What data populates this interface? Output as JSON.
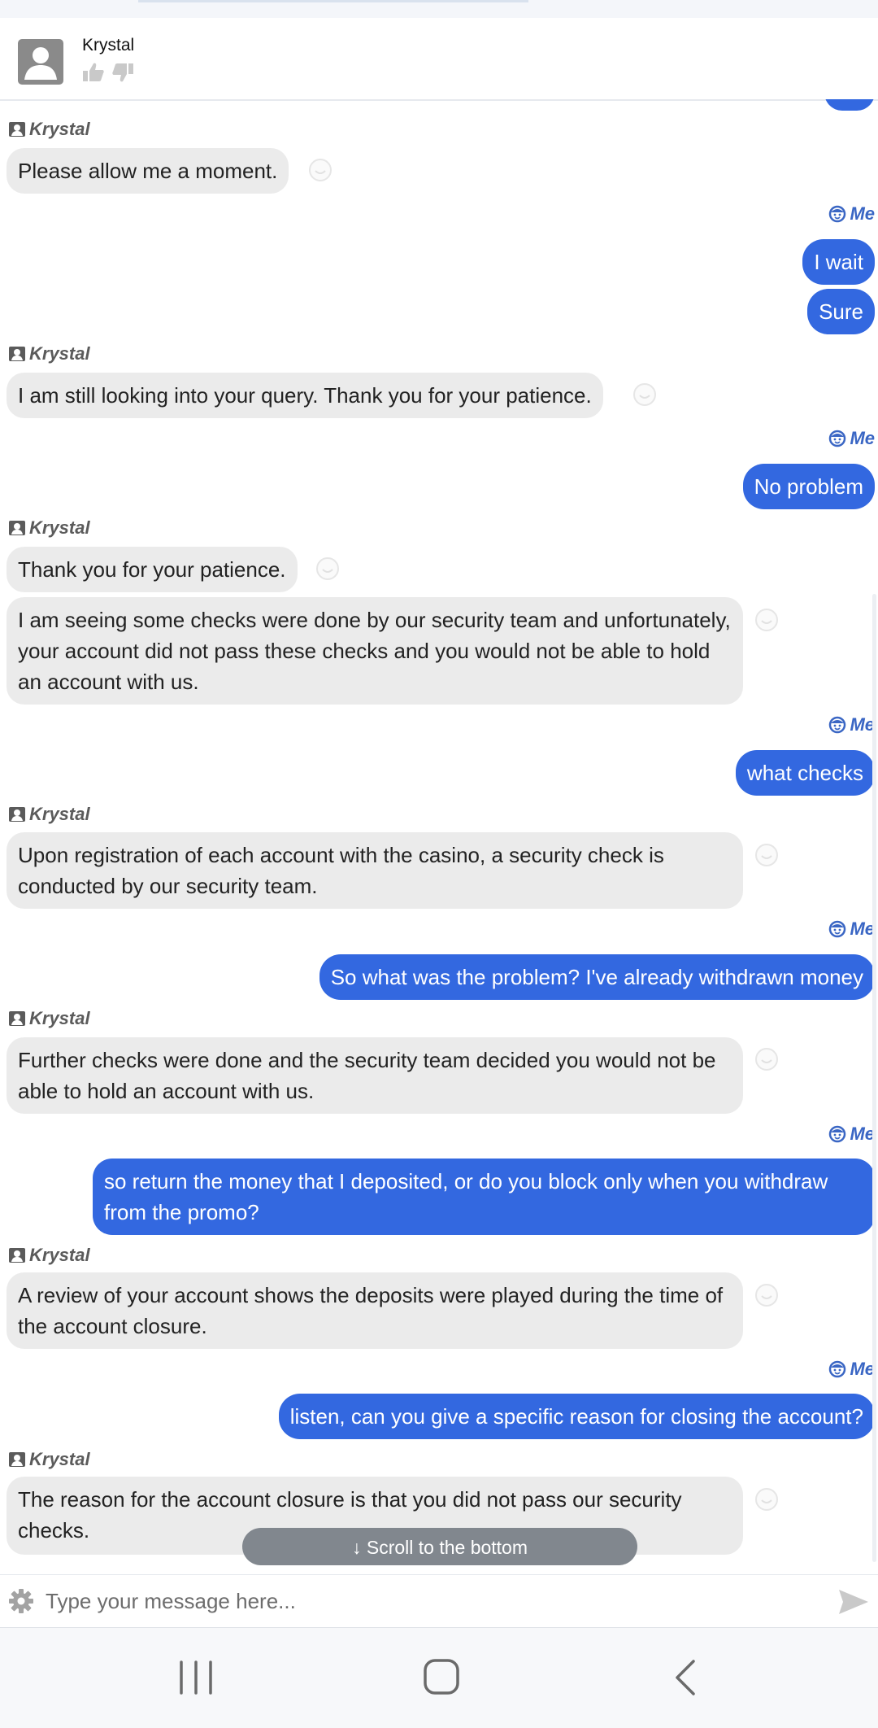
{
  "header": {
    "agent_name": "Krystal"
  },
  "conversation": [
    {
      "sender": "Krystal",
      "text": "Please allow me a moment."
    },
    {
      "sender": "Me",
      "text": "I wait"
    },
    {
      "sender": "Me",
      "text": "Sure"
    },
    {
      "sender": "Krystal",
      "text": "I am still looking into your query. Thank you for your patience."
    },
    {
      "sender": "Me",
      "text": "No problem"
    },
    {
      "sender": "Krystal",
      "text": "Thank you for your patience."
    },
    {
      "sender": "Krystal",
      "text": "I am seeing some checks were done by our security team and unfortunately, your account did not pass these checks and you would not be able to hold an account with us."
    },
    {
      "sender": "Me",
      "text": "what checks"
    },
    {
      "sender": "Krystal",
      "text": "Upon registration of each account with the casino, a security check is conducted by our security team."
    },
    {
      "sender": "Me",
      "text": "So what was the problem? I've already withdrawn money"
    },
    {
      "sender": "Krystal",
      "text": "Further checks were done and the security team decided you would not be able to hold an account with us."
    },
    {
      "sender": "Me",
      "text": "so return the money that I deposited, or do you block only when you withdraw from the promo?"
    },
    {
      "sender": "Krystal",
      "text": "A review of your account shows the deposits were played during the time of the account closure."
    },
    {
      "sender": "Me",
      "text": "listen, can you give a specific reason for closing the account?"
    },
    {
      "sender": "Krystal",
      "text": "The reason for the account closure is that you did not pass our security checks."
    }
  ],
  "labels": {
    "agent": "Krystal",
    "me": "Me"
  },
  "scroll_button": "↓ Scroll to the bottom",
  "input": {
    "placeholder": "Type your message here..."
  },
  "colors": {
    "me_bubble": "#3368e0",
    "agent_bubble": "#ebebeb",
    "me_label": "#3a66c4"
  },
  "icons": {
    "rate_up": "thumbs-up-icon",
    "rate_down": "thumbs-down-icon",
    "agent_label": "contact-card-icon",
    "me_label": "smiley-face-icon",
    "settings": "gear-icon",
    "send": "send-icon",
    "nav": [
      "recents-icon",
      "home-icon",
      "back-icon"
    ]
  }
}
